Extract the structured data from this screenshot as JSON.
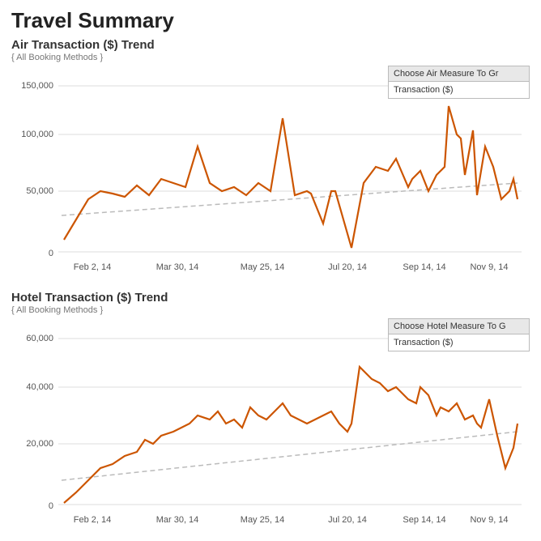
{
  "page": {
    "title": "Travel Summary"
  },
  "air_chart": {
    "title": "Air Transaction ($) Trend",
    "subtitle": "{ All Booking Methods }",
    "measure_label": "Choose Air Measure To Gr",
    "measure_option": "Transaction ($)",
    "x_labels": [
      "Feb 2, 14",
      "Mar 30, 14",
      "May 25, 14",
      "Jul 20, 14",
      "Sep 14, 14",
      "Nov 9, 14"
    ],
    "y_labels": [
      "150,000",
      "100,000",
      "50,000",
      "0"
    ]
  },
  "hotel_chart": {
    "title": "Hotel Transaction ($) Trend",
    "subtitle": "{ All Booking Methods }",
    "measure_label": "Choose Hotel Measure To G",
    "measure_option": "Transaction ($)",
    "x_labels": [
      "Feb 2, 14",
      "Mar 30, 14",
      "May 25, 14",
      "Jul 20, 14",
      "Sep 14, 14",
      "Nov 9, 14"
    ],
    "y_labels": [
      "60,000",
      "40,000",
      "20,000",
      "0"
    ]
  }
}
